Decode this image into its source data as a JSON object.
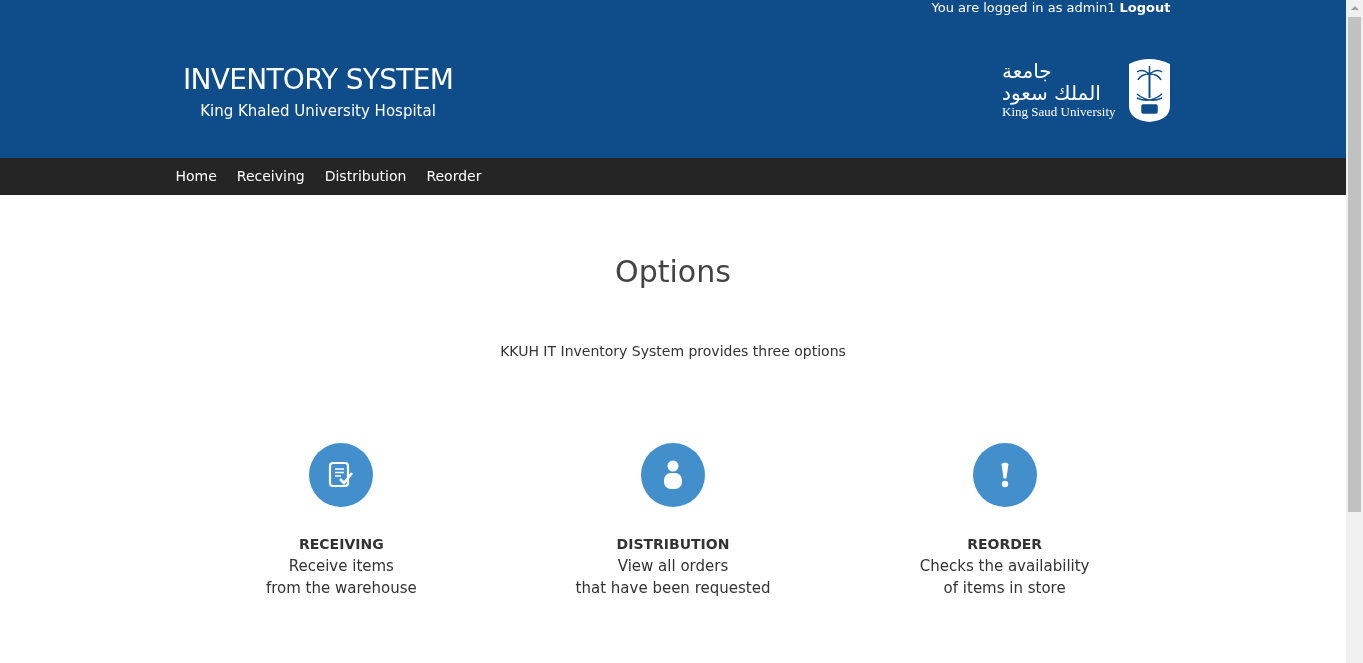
{
  "header": {
    "login_text": "You are logged in as admin1",
    "logout": "Logout",
    "title": "INVENTORY SYSTEM",
    "subtitle": "King Khaled University Hospital",
    "logo": {
      "arabic_line_1": "جامعة",
      "arabic_line_2": "الملك سعود",
      "english": "King Saud University"
    }
  },
  "nav": [
    {
      "label": "Home"
    },
    {
      "label": "Receiving"
    },
    {
      "label": "Distribution"
    },
    {
      "label": "Reorder"
    }
  ],
  "main": {
    "heading": "Options",
    "intro": "KKUH IT Inventory System provides three options",
    "options": [
      {
        "kind": "checklist",
        "title": "RECEIVING",
        "lines": [
          "Receive items",
          "from the warehouse"
        ]
      },
      {
        "kind": "person",
        "title": "DISTRIBUTION",
        "lines": [
          "View all orders",
          "that have been requested"
        ]
      },
      {
        "kind": "alert",
        "title": "REORDER",
        "lines": [
          "Checks the availability",
          "of items in store"
        ]
      }
    ]
  }
}
